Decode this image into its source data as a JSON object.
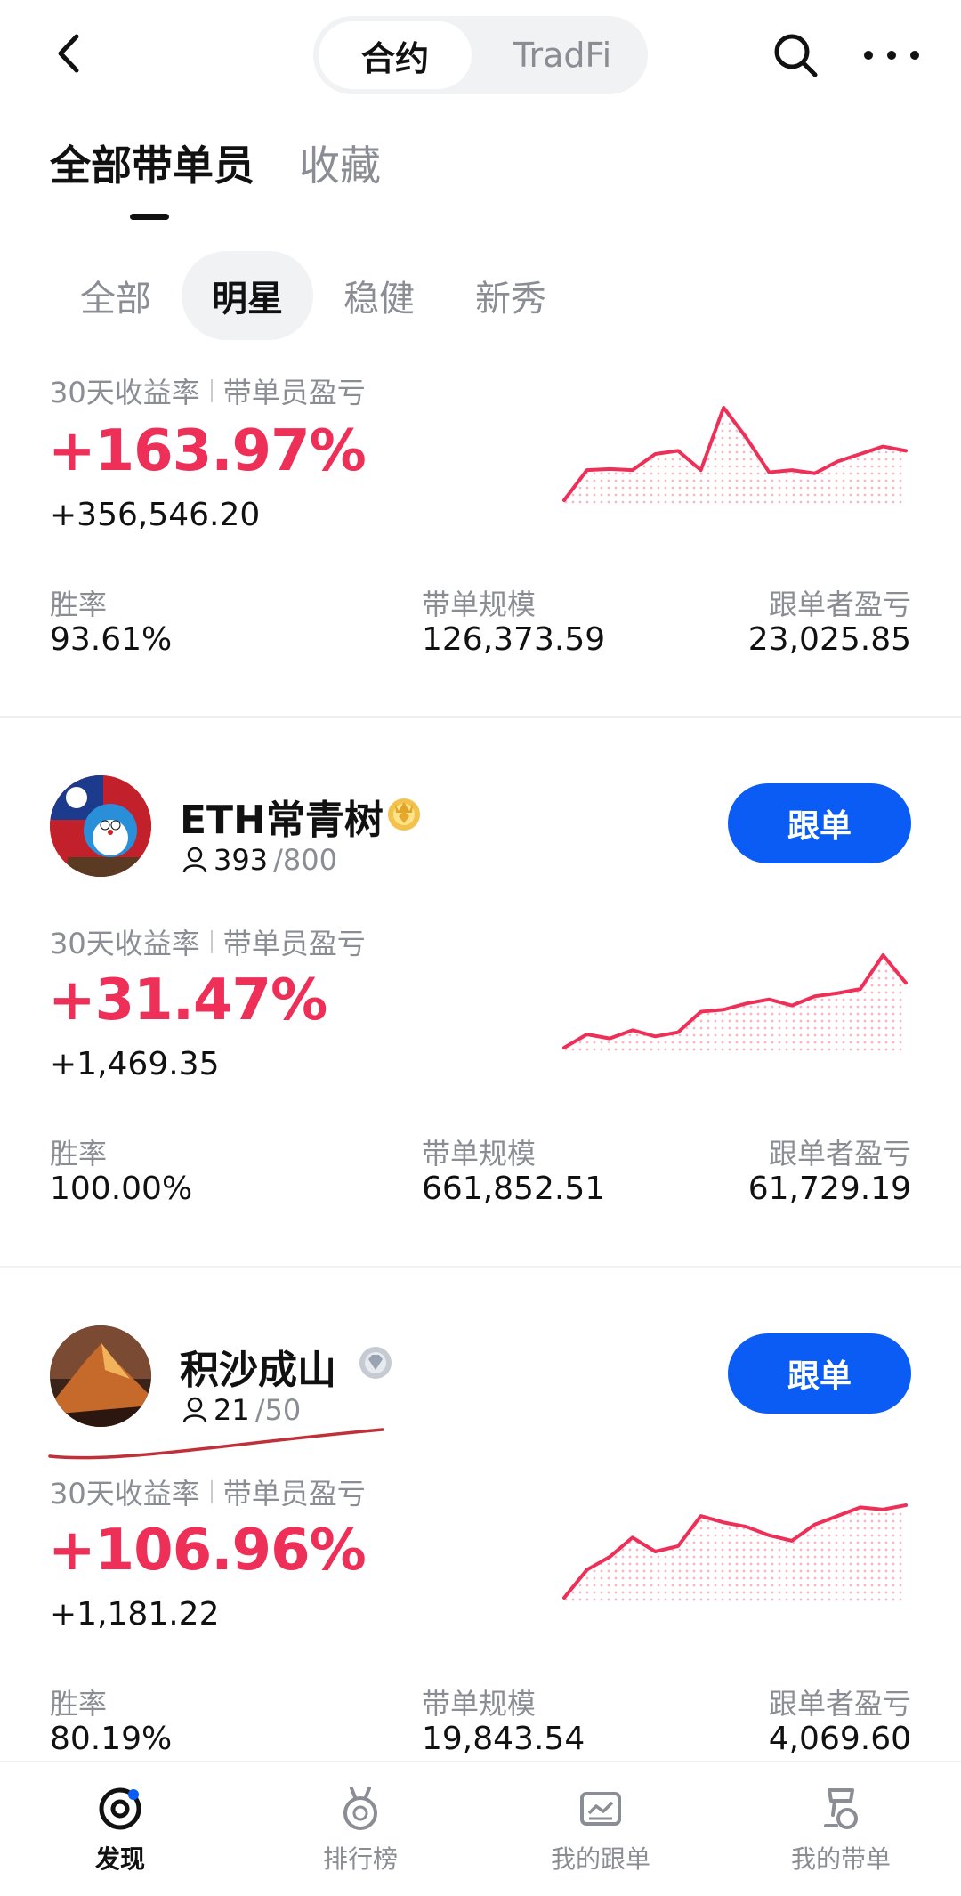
{
  "header": {
    "segment_active": "合约",
    "segment_inactive": "TradFi"
  },
  "main_tabs": [
    {
      "label": "全部带单员",
      "active": true
    },
    {
      "label": "收藏",
      "active": false
    }
  ],
  "sub_tabs": [
    {
      "label": "全部"
    },
    {
      "label": "明星"
    },
    {
      "label": "稳健"
    },
    {
      "label": "新秀"
    }
  ],
  "metric_label_a": "30天收益率",
  "metric_label_b": "带单员盈亏",
  "stat_labels": {
    "win_rate": "胜率",
    "scale": "带单规模",
    "follower_pnl": "跟单者盈亏"
  },
  "colors": {
    "accent_red": "#ee2f57",
    "follow_blue": "#0a5cf5"
  },
  "cards": [
    {
      "roi": "+163.97%",
      "pnl": "+356,546.20",
      "win_rate": "93.61%",
      "scale": "126,373.59",
      "follower_pnl": "23,025.85",
      "spark": [
        2,
        30,
        31,
        30,
        45,
        48,
        30,
        88,
        60,
        28,
        30,
        27,
        38,
        45,
        52,
        48
      ]
    },
    {
      "name": "ETH常青树",
      "badge": "gold-crown-icon",
      "followers": "393",
      "followers_max": "/800",
      "follow_label": "跟单",
      "roi": "+31.47%",
      "pnl": "+1,469.35",
      "win_rate": "100.00%",
      "scale": "661,852.51",
      "follower_pnl": "61,729.19",
      "spark": [
        5,
        18,
        14,
        22,
        16,
        20,
        40,
        42,
        48,
        52,
        46,
        55,
        58,
        62,
        95,
        68
      ]
    },
    {
      "name": "积沙成山",
      "badge": "silver-diamond-icon",
      "followers": "21",
      "followers_max": "/50",
      "follow_label": "跟单",
      "roi": "+106.96%",
      "pnl": "+1,181.22",
      "win_rate": "80.19%",
      "scale": "19,843.54",
      "follower_pnl": "4,069.60",
      "spark": [
        2,
        28,
        40,
        58,
        45,
        50,
        78,
        72,
        68,
        60,
        55,
        70,
        78,
        86,
        84,
        88
      ]
    }
  ],
  "bottom_nav": [
    {
      "label": "发现",
      "icon": "discover-icon",
      "active": true
    },
    {
      "label": "排行榜",
      "icon": "medal-icon",
      "active": false
    },
    {
      "label": "我的跟单",
      "icon": "chart-card-icon",
      "active": false
    },
    {
      "label": "我的带单",
      "icon": "trophy-icon",
      "active": false
    }
  ]
}
